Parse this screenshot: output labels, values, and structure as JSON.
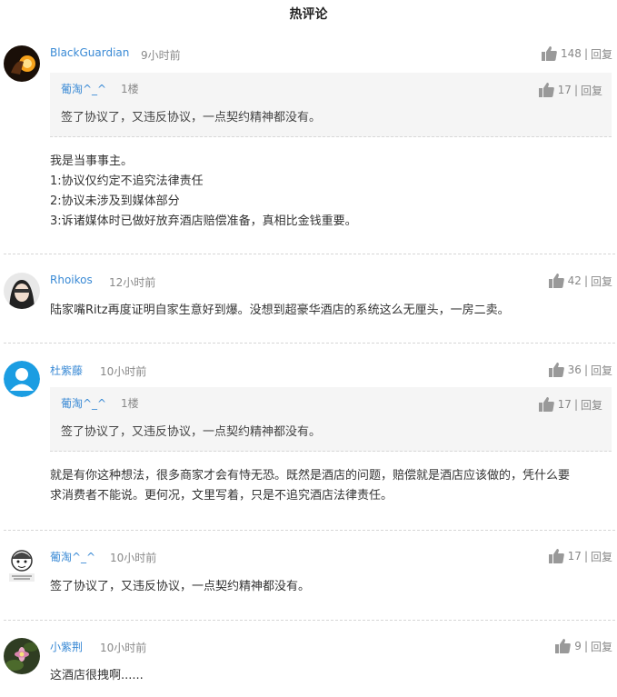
{
  "header": {
    "title": "热评论"
  },
  "reply_label": "回复",
  "comments": [
    {
      "user": "BlackGuardian",
      "time": "9小时前",
      "likes": "148",
      "quote": {
        "user": "葡淘^_^",
        "floor": "1楼",
        "likes": "17",
        "text": "签了协议了，又违反协议，一点契约精神都没有。"
      },
      "lines": [
        "我是当事事主。",
        "1:协议仅约定不追究法律责任",
        "2:协议未涉及到媒体部分",
        "3:诉诸媒体时已做好放弃酒店赔偿准备，真相比金钱重要。"
      ]
    },
    {
      "user": "Rhoikos",
      "time": "12小时前",
      "likes": "42",
      "lines": [
        "陆家嘴Ritz再度证明自家生意好到爆。没想到超豪华酒店的系统这么无厘头，一房二卖。"
      ]
    },
    {
      "user": "杜紫藤",
      "time": "10小时前",
      "likes": "36",
      "quote": {
        "user": "葡淘^_^",
        "floor": "1楼",
        "likes": "17",
        "text": "签了协议了，又违反协议，一点契约精神都没有。"
      },
      "lines": [
        "就是有你这种想法，很多商家才会有恃无恐。既然是酒店的问题，赔偿就是酒店应该做的，凭什么要",
        "求消费者不能说。更何况，文里写着，只是不追究酒店法律责任。"
      ]
    },
    {
      "user": "葡淘^_^",
      "time": "10小时前",
      "likes": "17",
      "lines": [
        "签了协议了，又违反协议，一点契约精神都没有。"
      ]
    },
    {
      "user": "小紫荆",
      "time": "10小时前",
      "likes": "9",
      "lines": [
        "这酒店很拽啊......"
      ]
    }
  ],
  "colors": {
    "link": "#3a8ad5",
    "meta": "#888888",
    "quote_bg": "#f5f5f5",
    "default_avatar": "#1b9de2"
  },
  "icons": [
    "thumbs-up-icon",
    "default-user-avatar-icon"
  ]
}
